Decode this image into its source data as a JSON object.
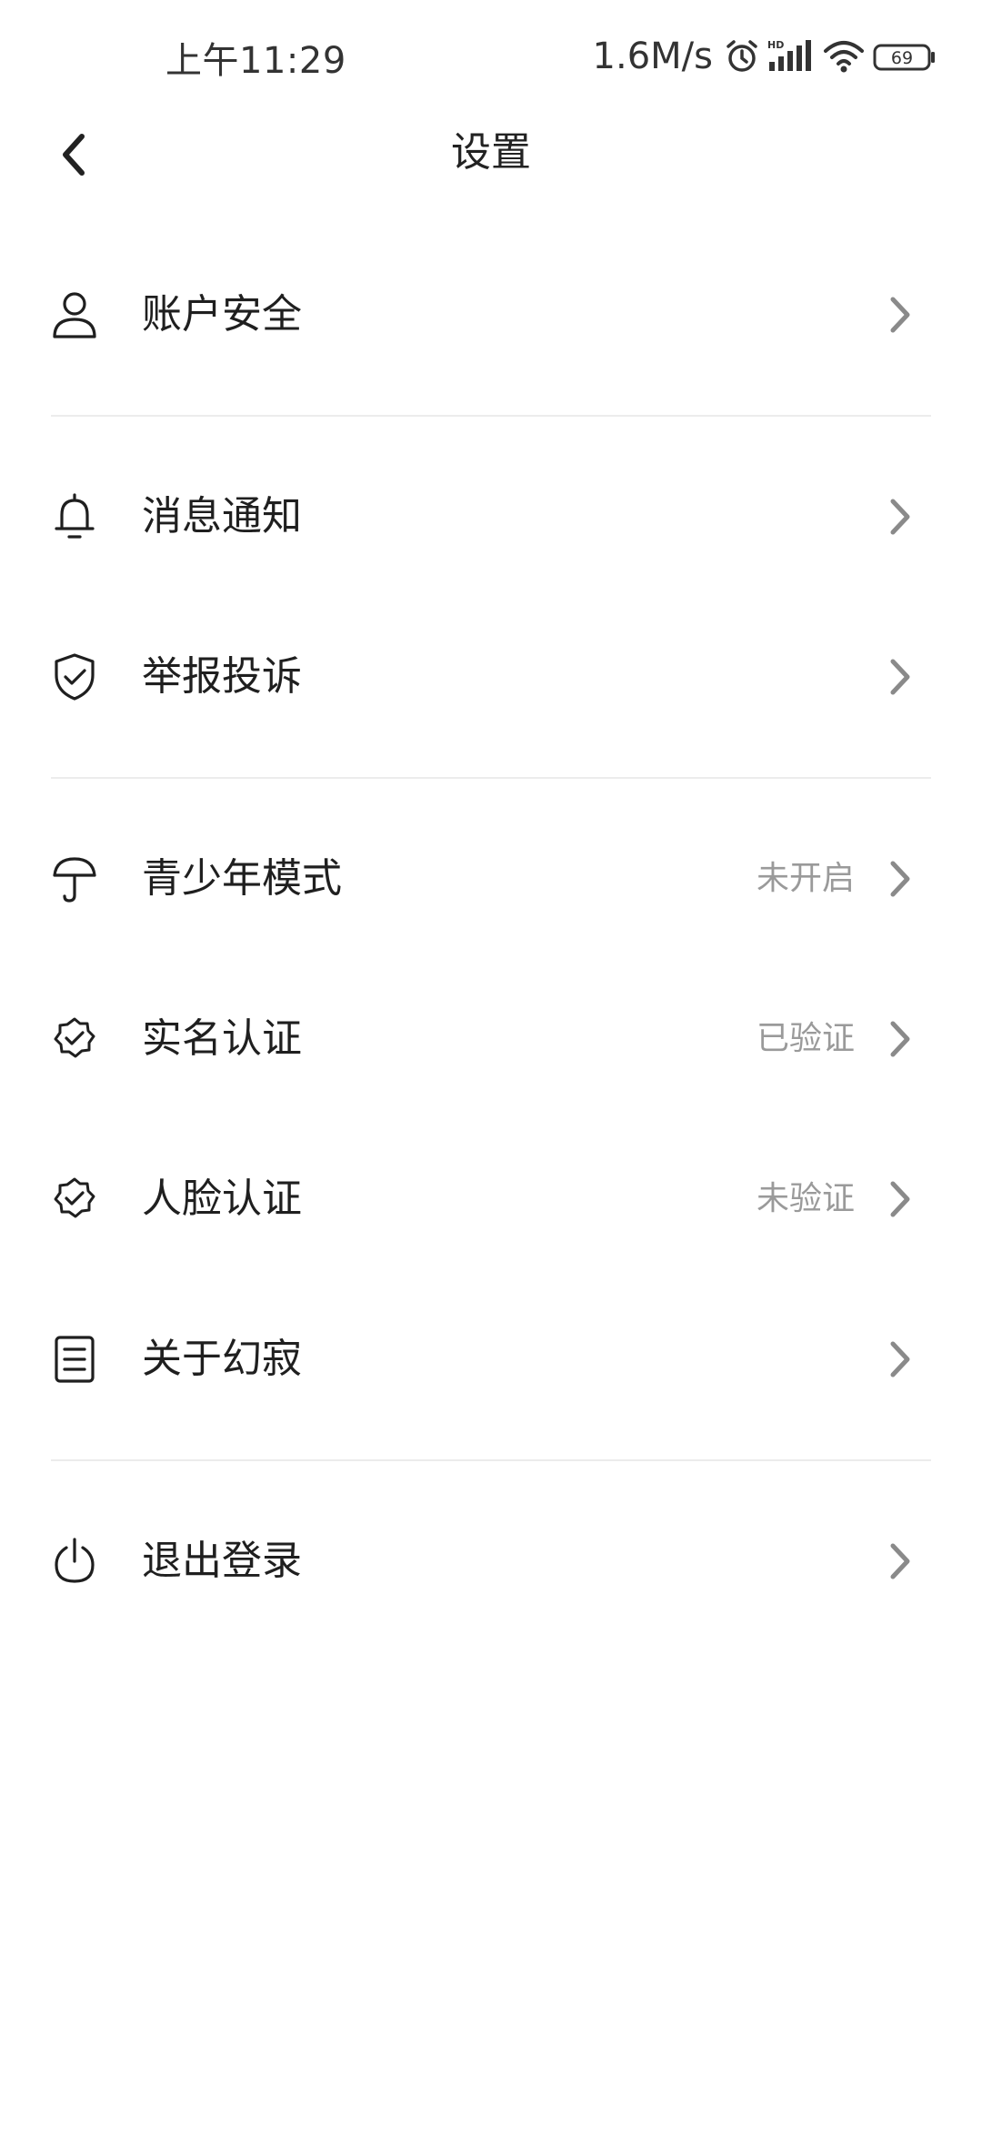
{
  "status_bar": {
    "time": "上午11:29",
    "net_speed": "1.6M/s",
    "battery": "69",
    "icons": [
      "alarm-icon",
      "hd-signal-icon",
      "wifi-icon",
      "battery-icon"
    ]
  },
  "header": {
    "title": "设置",
    "back_icon": "chevron-left-icon"
  },
  "menu": {
    "items": [
      {
        "label": "账户安全",
        "status": "",
        "icon": "user-icon"
      },
      {
        "label": "消息通知",
        "status": "",
        "icon": "bell-icon"
      },
      {
        "label": "举报投诉",
        "status": "",
        "icon": "shield-check-icon"
      },
      {
        "label": "青少年模式",
        "status": "未开启",
        "icon": "umbrella-icon"
      },
      {
        "label": "实名认证",
        "status": "已验证",
        "icon": "verified-badge-icon"
      },
      {
        "label": "人脸认证",
        "status": "未验证",
        "icon": "verified-badge-icon"
      },
      {
        "label": "关于幻寂",
        "status": "",
        "icon": "document-icon"
      },
      {
        "label": "退出登录",
        "status": "",
        "icon": "power-icon"
      }
    ]
  },
  "colors": {
    "text": "#1f1f1f",
    "secondary_text": "#9a9a9a",
    "chevron": "#8a8a8a",
    "divider": "#ececec",
    "background": "#ffffff"
  }
}
